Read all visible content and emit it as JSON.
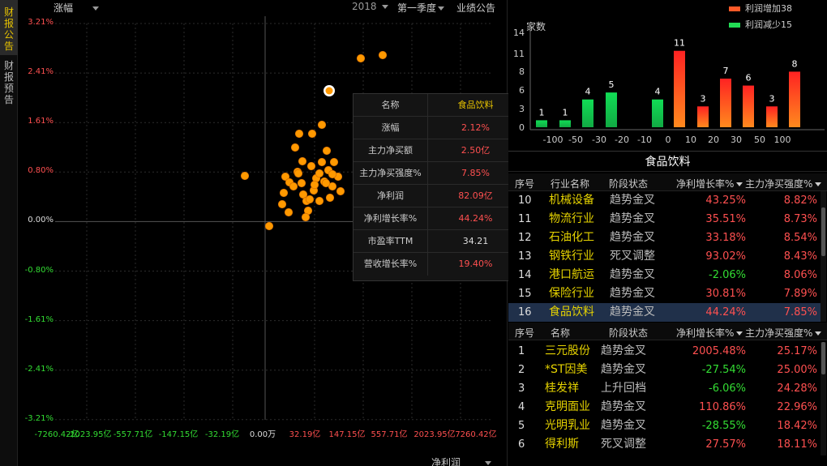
{
  "sidebar": {
    "tabs": [
      {
        "label": "财报公告",
        "active": true
      },
      {
        "label": "财报预告",
        "active": false
      }
    ]
  },
  "scatter": {
    "toolbar": {
      "metric": "涨幅",
      "year": "2018",
      "quarter": "第一季度",
      "report_type": "业绩公告"
    },
    "x_selector": "净利润",
    "y_ticks": [
      "3.21%",
      "2.41%",
      "1.61%",
      "0.80%",
      "0.00%",
      "-0.80%",
      "-1.61%",
      "-2.41%",
      "-3.21%"
    ],
    "x_ticks": [
      "-7260.42亿",
      "-2023.95亿",
      "-557.71亿",
      "-147.15亿",
      "-32.19亿",
      "0.00万",
      "32.19亿",
      "147.15亿",
      "557.71亿",
      "2023.95亿",
      "7260.42亿"
    ],
    "tooltip": {
      "header_key": "名称",
      "header_value": "食品饮料",
      "rows": [
        {
          "k": "涨幅",
          "v": "2.12%",
          "c": "pos"
        },
        {
          "k": "主力净买额",
          "v": "2.50亿",
          "c": "pos"
        },
        {
          "k": "主力净买强度%",
          "v": "7.85%",
          "c": "pos"
        },
        {
          "k": "净利润",
          "v": "82.09亿",
          "c": "pos"
        },
        {
          "k": "净利增长率%",
          "v": "44.24%",
          "c": "pos"
        },
        {
          "k": "市盈率TTM",
          "v": "34.21",
          "c": "neu"
        },
        {
          "k": "营收增长率%",
          "v": "19.40%",
          "c": "pos"
        }
      ]
    }
  },
  "colors": {
    "up": "#ff5050",
    "down": "#33dd33",
    "name": "#e6d300",
    "dot": "#ff9900",
    "accent": "#e6c200"
  },
  "chart_data": {
    "type": "bar",
    "ylabel": "家数",
    "yticks": [
      "14",
      "11",
      "8",
      "6",
      "3",
      "0"
    ],
    "ylim": [
      0,
      14
    ],
    "categories": [
      "-100",
      "-50",
      "-30",
      "-20",
      "-10",
      "0",
      "10",
      "20",
      "30",
      "50",
      "100"
    ],
    "values": [
      1,
      1,
      4,
      5,
      null,
      4,
      11,
      3,
      7,
      6,
      3,
      8
    ],
    "bars": [
      {
        "v": 1,
        "s": "down"
      },
      {
        "v": 1,
        "s": "down"
      },
      {
        "v": 4,
        "s": "down"
      },
      {
        "v": 5,
        "s": "down"
      },
      {
        "v": 4,
        "s": "down"
      },
      {
        "v": 11,
        "s": "up"
      },
      {
        "v": 3,
        "s": "up"
      },
      {
        "v": 7,
        "s": "up"
      },
      {
        "v": 6,
        "s": "up"
      },
      {
        "v": 3,
        "s": "up"
      },
      {
        "v": 8,
        "s": "up"
      }
    ],
    "legend": [
      "利润增加38",
      "利润减少15"
    ]
  },
  "industry_panel": {
    "title": "食品饮料",
    "headers": [
      "序号",
      "行业名称",
      "阶段状态",
      "净利增长率%",
      "主力净买强度%"
    ],
    "rows": [
      {
        "idx": "10",
        "name": "机械设备",
        "stage": "趋势金叉",
        "growth": "43.25%",
        "gc": "pos",
        "strength": "8.82%",
        "sc": "pos"
      },
      {
        "idx": "11",
        "name": "物流行业",
        "stage": "趋势金叉",
        "growth": "35.51%",
        "gc": "pos",
        "strength": "8.73%",
        "sc": "pos"
      },
      {
        "idx": "12",
        "name": "石油化工",
        "stage": "趋势金叉",
        "growth": "33.18%",
        "gc": "pos",
        "strength": "8.54%",
        "sc": "pos"
      },
      {
        "idx": "13",
        "name": "钢铁行业",
        "stage": "死叉调整",
        "growth": "93.02%",
        "gc": "pos",
        "strength": "8.43%",
        "sc": "pos"
      },
      {
        "idx": "14",
        "name": "港口航运",
        "stage": "趋势金叉",
        "growth": "-2.06%",
        "gc": "neg",
        "strength": "8.06%",
        "sc": "pos"
      },
      {
        "idx": "15",
        "name": "保险行业",
        "stage": "趋势金叉",
        "growth": "30.81%",
        "gc": "pos",
        "strength": "7.89%",
        "sc": "pos"
      },
      {
        "idx": "16",
        "name": "食品饮料",
        "stage": "趋势金叉",
        "growth": "44.24%",
        "gc": "pos",
        "strength": "7.85%",
        "sc": "pos",
        "selected": true
      }
    ]
  },
  "stock_panel": {
    "headers": [
      "序号",
      "名称",
      "阶段状态",
      "净利增长率%",
      "主力净买强度%"
    ],
    "rows": [
      {
        "idx": "1",
        "name": "三元股份",
        "stage": "趋势金叉",
        "growth": "2005.48%",
        "gc": "pos",
        "strength": "25.17%",
        "sc": "pos"
      },
      {
        "idx": "2",
        "name": "*ST因美",
        "stage": "趋势金叉",
        "growth": "-27.54%",
        "gc": "neg",
        "strength": "25.00%",
        "sc": "pos"
      },
      {
        "idx": "3",
        "name": "桂发祥",
        "stage": "上升回档",
        "growth": "-6.06%",
        "gc": "neg",
        "strength": "24.28%",
        "sc": "pos"
      },
      {
        "idx": "4",
        "name": "克明面业",
        "stage": "趋势金叉",
        "growth": "110.86%",
        "gc": "pos",
        "strength": "22.96%",
        "sc": "pos"
      },
      {
        "idx": "5",
        "name": "光明乳业",
        "stage": "趋势金叉",
        "growth": "-28.55%",
        "gc": "neg",
        "strength": "18.42%",
        "sc": "pos"
      },
      {
        "idx": "6",
        "name": "得利斯",
        "stage": "死叉调整",
        "growth": "27.57%",
        "gc": "pos",
        "strength": "18.11%",
        "sc": "pos"
      }
    ]
  }
}
